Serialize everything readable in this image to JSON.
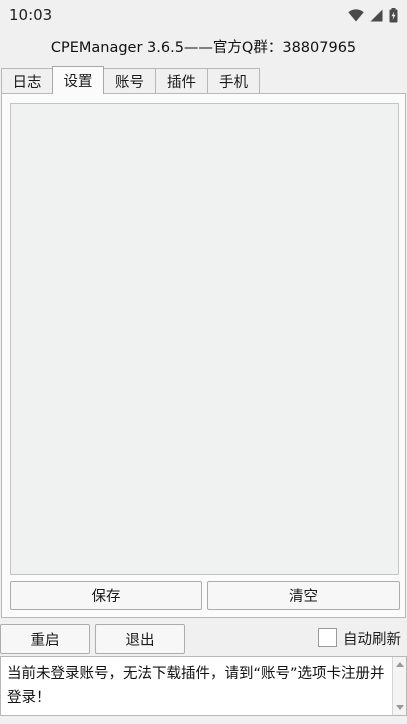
{
  "status_bar": {
    "time": "10:03",
    "icons": [
      "wifi-icon",
      "cellular-signal-icon",
      "battery-charging-icon"
    ]
  },
  "app": {
    "title": "CPEManager 3.6.5——官方Q群：38807965"
  },
  "tabs": [
    {
      "label": "日志",
      "active": false
    },
    {
      "label": "设置",
      "active": true
    },
    {
      "label": "账号",
      "active": false
    },
    {
      "label": "插件",
      "active": false
    },
    {
      "label": "手机",
      "active": false
    }
  ],
  "settings_panel": {
    "text_value": "",
    "save_label": "保存",
    "clear_label": "清空"
  },
  "bottom_bar": {
    "restart_label": "重启",
    "exit_label": "退出",
    "auto_refresh_label": "自动刷新",
    "auto_refresh_checked": false
  },
  "log": {
    "message": "当前未登录账号，无法下载插件，请到“账号”选项卡注册并登录！"
  },
  "colors": {
    "background": "#f0f0f0",
    "panel": "#fbfbfb",
    "border": "#b8b8b8"
  }
}
